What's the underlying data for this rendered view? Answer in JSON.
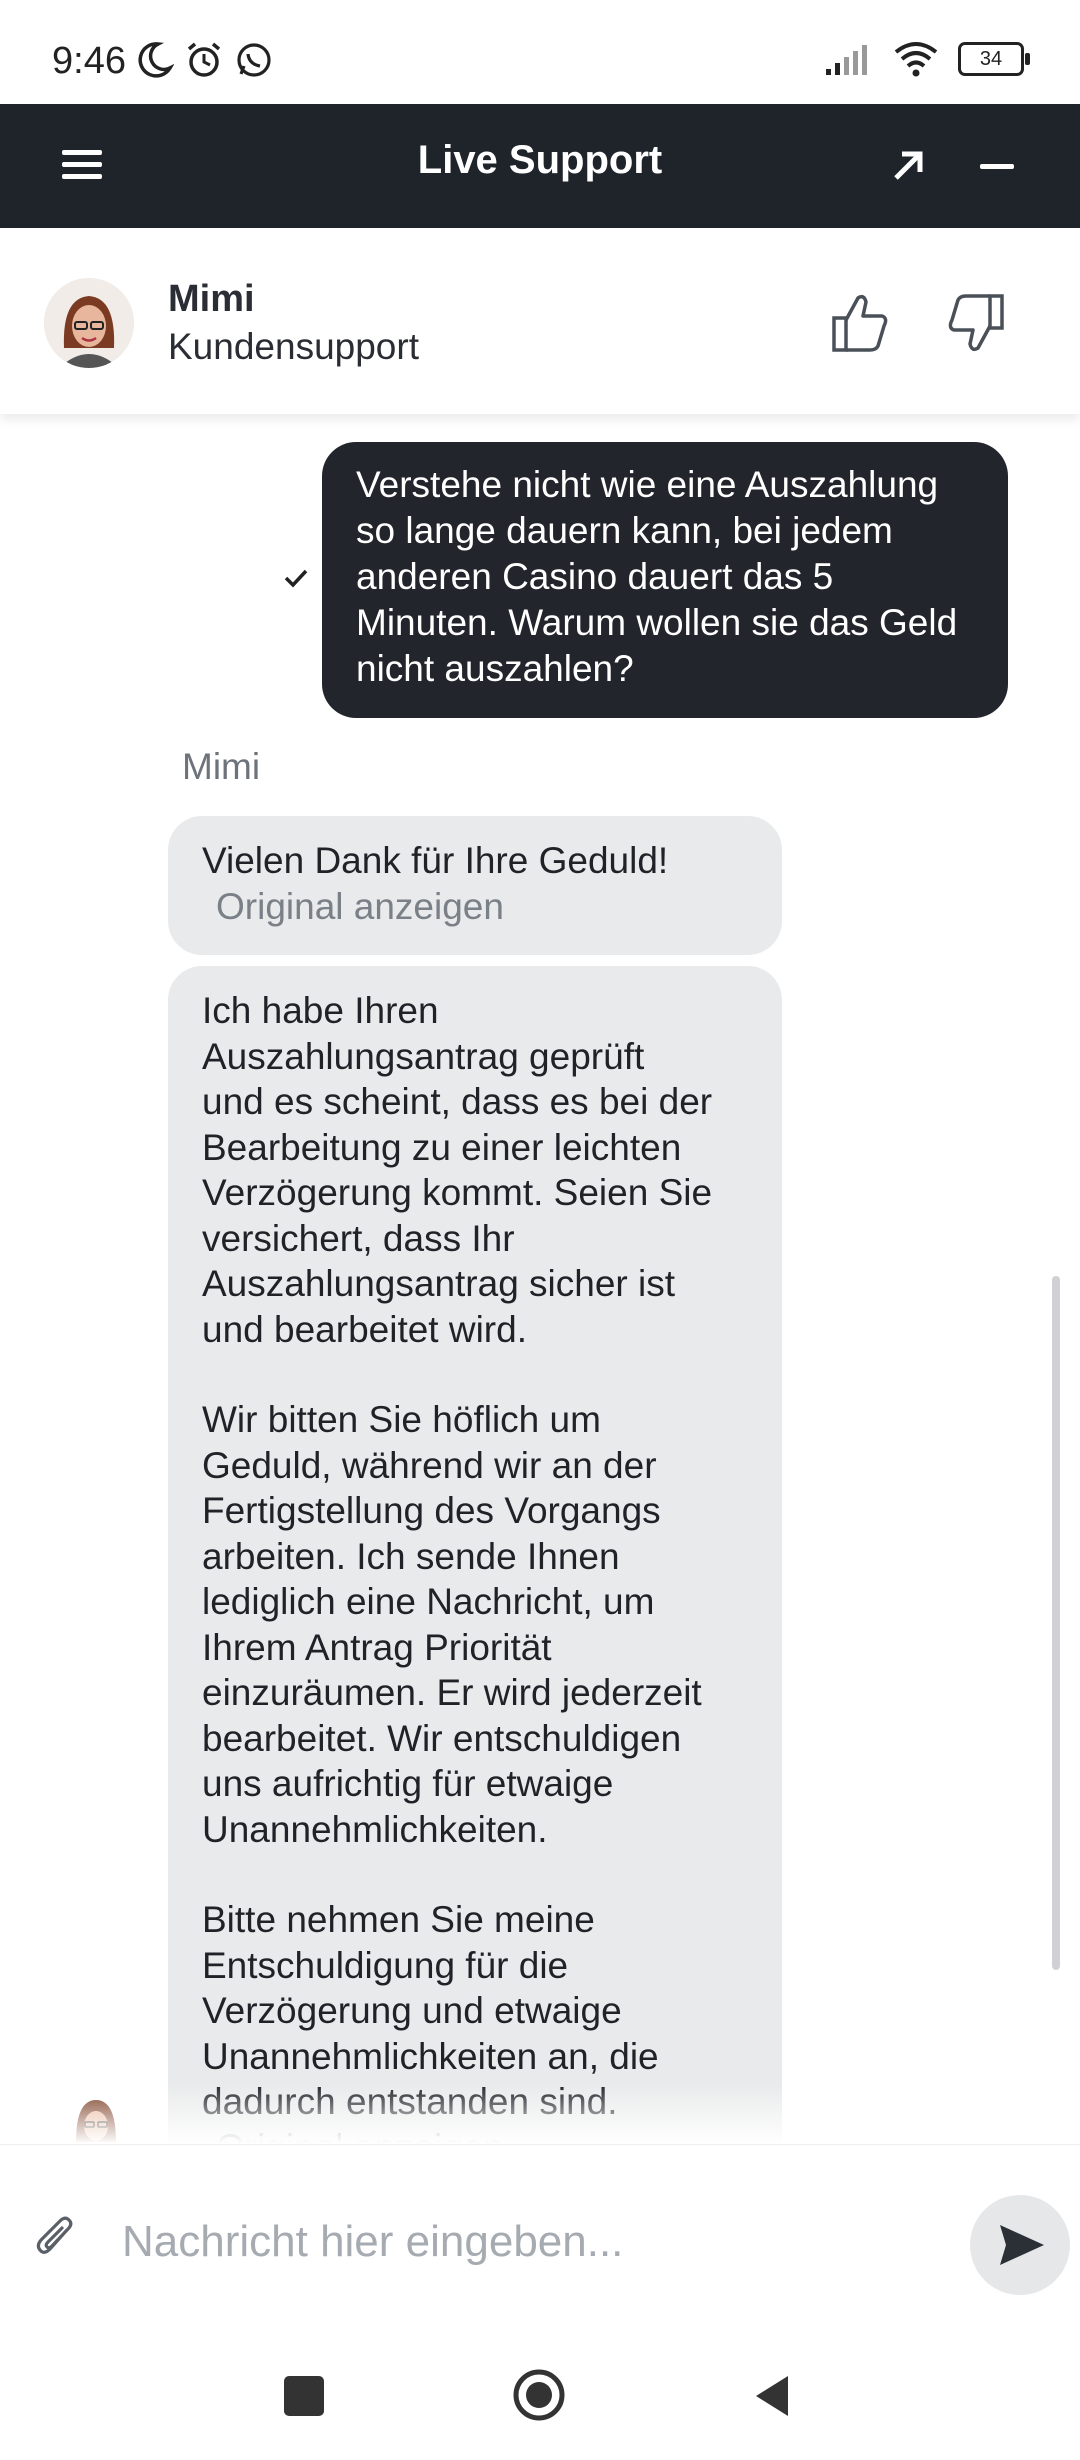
{
  "status_bar": {
    "time": "9:46",
    "battery_level": "34",
    "icons_left": [
      "moon-icon",
      "alarm-icon",
      "whatsapp-icon"
    ],
    "icons_right": [
      "signal-icon",
      "wifi-icon",
      "battery-icon"
    ]
  },
  "app_bar": {
    "title": "Live Support",
    "background": "#1f232a"
  },
  "agent": {
    "name": "Mimi",
    "role": "Kundensupport"
  },
  "messages": {
    "user_message": "Verstehe nicht wie eine Auszahlung so lange dauern kann, bei jedem anderen Casino dauert das 5 Minuten. Warum wollen sie das Geld nicht auszahlen?",
    "agent_name_label": "Mimi",
    "agent_message_1": "Vielen Dank für Ihre Geduld!",
    "agent_message_2": {
      "paragraph_1": "Ich habe Ihren\nAuszahlungsantrag geprüft\nund es scheint, dass es bei der\nBearbeitung zu einer leichten\nVerzögerung kommt. Seien Sie\nversichert, dass Ihr\nAuszahlungsantrag sicher ist\nund bearbeitet wird.",
      "paragraph_2": "Wir bitten Sie höflich um\nGeduld, während wir an der\nFertigstellung des Vorgangs\narbeiten. Ich sende Ihnen\nlediglich eine Nachricht, um\nIhrem Antrag Priorität\neinzuräumen. Er wird jederzeit\nbearbeitet. Wir entschuldigen\nuns aufrichtig für etwaige\nUnannehmlichkeiten.",
      "paragraph_3": "Bitte nehmen Sie meine\nEntschuldigung für die\nVerzögerung und etwaige\nUnannehmlichkeiten an, die\ndadurch entstanden sind."
    },
    "show_original_label": "Original anzeigen"
  },
  "composer": {
    "placeholder": "Nachricht hier eingeben..."
  }
}
